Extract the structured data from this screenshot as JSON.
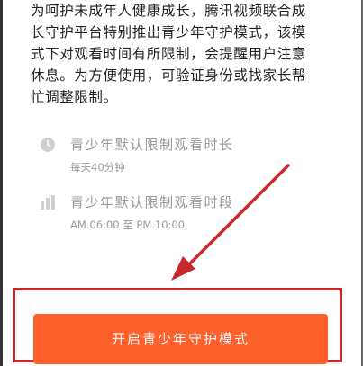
{
  "intro": {
    "lines": [
      "为呵护未成年人健康成长，腾讯视频联合成",
      "长守护平台特别推出青少年守护模式，该模",
      "式下对观看时间有所限制，会提醒用户注意",
      "休息。为方便使用，可验证身份或找家长帮",
      "忙调整限制。"
    ]
  },
  "limits": {
    "duration": {
      "icon": "clock-icon",
      "title": "青少年默认限制观看时长",
      "detail": "每天40分钟"
    },
    "period": {
      "icon": "bar-chart-icon",
      "title": "青少年默认限制观看时段",
      "detail": "AM.06:00 至 PM.10:00"
    }
  },
  "action": {
    "enable_label": "开启青少年守护模式"
  },
  "colors": {
    "accent": "#ff5f2a",
    "annotation": "#c8282d",
    "muted_text": "#9a9a9a",
    "icon_gray": "#cfcfcf"
  }
}
